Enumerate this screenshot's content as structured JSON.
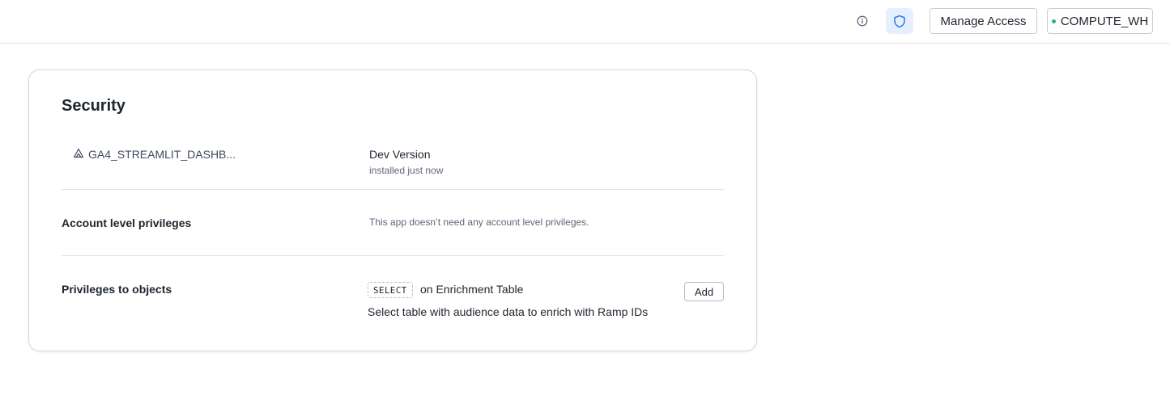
{
  "topbar": {
    "info_icon": "info-circle-icon",
    "shield_icon": "shield-icon",
    "manage_access_label": "Manage Access",
    "warehouse_label": "COMPUTE_WH",
    "warehouse_status_color": "#22b573",
    "shield_active_bg": "#e5efff"
  },
  "security": {
    "title": "Security",
    "app": {
      "icon": "streamlit-app-icon",
      "name": "GA4_STREAMLIT_DASHB...",
      "version": "Dev Version",
      "installed": "installed just now"
    },
    "account_privileges": {
      "label": "Account level privileges",
      "note": "This app doesn’t need any account level privileges."
    },
    "object_privileges": {
      "label": "Privileges to objects",
      "privilege": "SELECT",
      "object": "on Enrichment Table",
      "description": "Select table with audience data to enrich with Ramp IDs",
      "add_label": "Add"
    }
  }
}
